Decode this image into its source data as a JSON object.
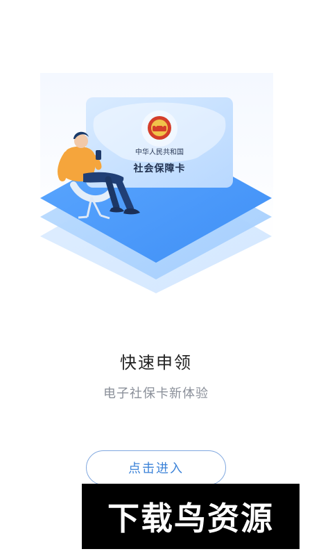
{
  "card": {
    "country": "中华人民共和国",
    "name": "社会保障卡"
  },
  "main": {
    "title": "快速申领",
    "subtitle": "电子社保卡新体验",
    "button_label": "点击进入"
  },
  "watermark": {
    "text": "下载鸟资源"
  },
  "colors": {
    "accent": "#3b82d8",
    "button_border": "#7fa7df",
    "background": "#ffffff",
    "title": "#222222",
    "subtitle": "#8a8f99",
    "watermark_bg": "#000000"
  },
  "icons": {
    "emblem": "national-emblem-icon"
  }
}
